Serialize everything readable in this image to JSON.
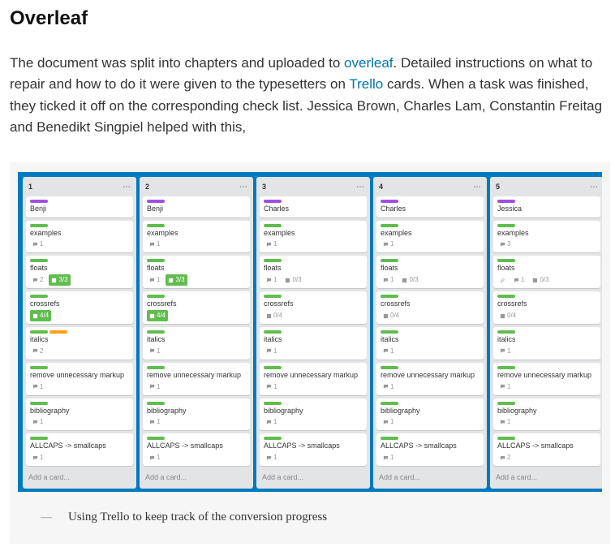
{
  "heading": "Overleaf",
  "paragraph": {
    "t1": "The document was split into chapters and uploaded to ",
    "link1": "overleaf",
    "t2": ". Detailed instructions on what to repair and how to do it were given to the typesetters on ",
    "link2": "Trello",
    "t3": " cards. When a task was finished, they ticked it off on the corresponding check list. Jessica Brown, Charles Lam, Constantin Freitag and Benedikt Singpiel helped with this,"
  },
  "board": {
    "lists": [
      {
        "title": "1",
        "cards": [
          {
            "labels": [
              "purple"
            ],
            "title": "Benji",
            "comments": null,
            "check": null
          },
          {
            "labels": [
              "green"
            ],
            "title": "examples",
            "comments": 1,
            "check": null
          },
          {
            "labels": [
              "green"
            ],
            "title": "floats",
            "comments": 2,
            "check": {
              "text": "3/3",
              "done": true
            }
          },
          {
            "labels": [
              "green"
            ],
            "title": "crossrefs",
            "comments": null,
            "check": {
              "text": "4/4",
              "done": true
            }
          },
          {
            "labels": [
              "green",
              "orange"
            ],
            "title": "italics",
            "comments": 2,
            "check": null
          },
          {
            "labels": [
              "green"
            ],
            "title": "remove unnecessary markup",
            "comments": 1,
            "check": null
          },
          {
            "labels": [
              "green"
            ],
            "title": "bibliography",
            "comments": 1,
            "check": null
          },
          {
            "labels": [
              "green"
            ],
            "title": "ALLCAPS -> smallcaps",
            "comments": 1,
            "check": null
          }
        ],
        "add": "Add a card..."
      },
      {
        "title": "2",
        "cards": [
          {
            "labels": [
              "purple"
            ],
            "title": "Benji",
            "comments": null,
            "check": null
          },
          {
            "labels": [
              "green"
            ],
            "title": "examples",
            "comments": 1,
            "check": null
          },
          {
            "labels": [
              "green"
            ],
            "title": "floats",
            "comments": 1,
            "check": {
              "text": "3/3",
              "done": true
            }
          },
          {
            "labels": [
              "green"
            ],
            "title": "crossrefs",
            "comments": null,
            "check": {
              "text": "4/4",
              "done": true
            }
          },
          {
            "labels": [
              "green"
            ],
            "title": "italics",
            "comments": 1,
            "check": null
          },
          {
            "labels": [
              "green"
            ],
            "title": "remove unnecessary markup",
            "comments": 1,
            "check": null
          },
          {
            "labels": [
              "green"
            ],
            "title": "bibliography",
            "comments": 1,
            "check": null
          },
          {
            "labels": [
              "green"
            ],
            "title": "ALLCAPS -> smallcaps",
            "comments": 1,
            "check": null
          }
        ],
        "add": "Add a card..."
      },
      {
        "title": "3",
        "cards": [
          {
            "labels": [
              "purple"
            ],
            "title": "Charles",
            "comments": null,
            "check": null
          },
          {
            "labels": [
              "green"
            ],
            "title": "examples",
            "comments": 1,
            "check": null
          },
          {
            "labels": [
              "green"
            ],
            "title": "floats",
            "comments": 1,
            "check": {
              "text": "0/3",
              "done": false
            }
          },
          {
            "labels": [
              "green"
            ],
            "title": "crossrefs",
            "comments": null,
            "check": {
              "text": "0/4",
              "done": false
            }
          },
          {
            "labels": [
              "green"
            ],
            "title": "italics",
            "comments": 1,
            "check": null
          },
          {
            "labels": [
              "green"
            ],
            "title": "remove unnecessary markup",
            "comments": 1,
            "check": null
          },
          {
            "labels": [
              "green"
            ],
            "title": "bibliography",
            "comments": 1,
            "check": null
          },
          {
            "labels": [
              "green"
            ],
            "title": "ALLCAPS -> smallcaps",
            "comments": 1,
            "check": null
          }
        ],
        "add": "Add a card..."
      },
      {
        "title": "4",
        "cards": [
          {
            "labels": [
              "purple"
            ],
            "title": "Charles",
            "comments": null,
            "check": null
          },
          {
            "labels": [
              "green"
            ],
            "title": "examples",
            "comments": 1,
            "check": null
          },
          {
            "labels": [
              "green"
            ],
            "title": "floats",
            "comments": 1,
            "check": {
              "text": "0/3",
              "done": false
            }
          },
          {
            "labels": [
              "green"
            ],
            "title": "crossrefs",
            "comments": null,
            "check": {
              "text": "0/4",
              "done": false
            }
          },
          {
            "labels": [
              "green"
            ],
            "title": "italics",
            "comments": 1,
            "check": null
          },
          {
            "labels": [
              "green"
            ],
            "title": "remove unnecessary markup",
            "comments": 1,
            "check": null
          },
          {
            "labels": [
              "green"
            ],
            "title": "bibliography",
            "comments": 1,
            "check": null
          },
          {
            "labels": [
              "green"
            ],
            "title": "ALLCAPS -> smallcaps",
            "comments": 1,
            "check": null
          }
        ],
        "add": "Add a card..."
      },
      {
        "title": "5",
        "cards": [
          {
            "labels": [
              "purple"
            ],
            "title": "Jessica",
            "comments": null,
            "check": null
          },
          {
            "labels": [
              "green"
            ],
            "title": "examples",
            "comments": 3,
            "check": null
          },
          {
            "labels": [
              "green"
            ],
            "title": "floats",
            "comments": 1,
            "check": {
              "text": "0/3",
              "done": false
            },
            "attach": true
          },
          {
            "labels": [
              "green"
            ],
            "title": "crossrefs",
            "comments": null,
            "check": {
              "text": "0/4",
              "done": false
            }
          },
          {
            "labels": [
              "green"
            ],
            "title": "italics",
            "comments": 1,
            "check": null
          },
          {
            "labels": [
              "green"
            ],
            "title": "remove unnecessary markup",
            "comments": 1,
            "check": null
          },
          {
            "labels": [
              "green"
            ],
            "title": "bibliography",
            "comments": 1,
            "check": null
          },
          {
            "labels": [
              "green"
            ],
            "title": "ALLCAPS -> smallcaps",
            "comments": 2,
            "check": null
          }
        ],
        "add": "Add a card..."
      }
    ]
  },
  "caption": {
    "dash": "—",
    "text": "Using Trello to keep track of the conversion progress"
  }
}
